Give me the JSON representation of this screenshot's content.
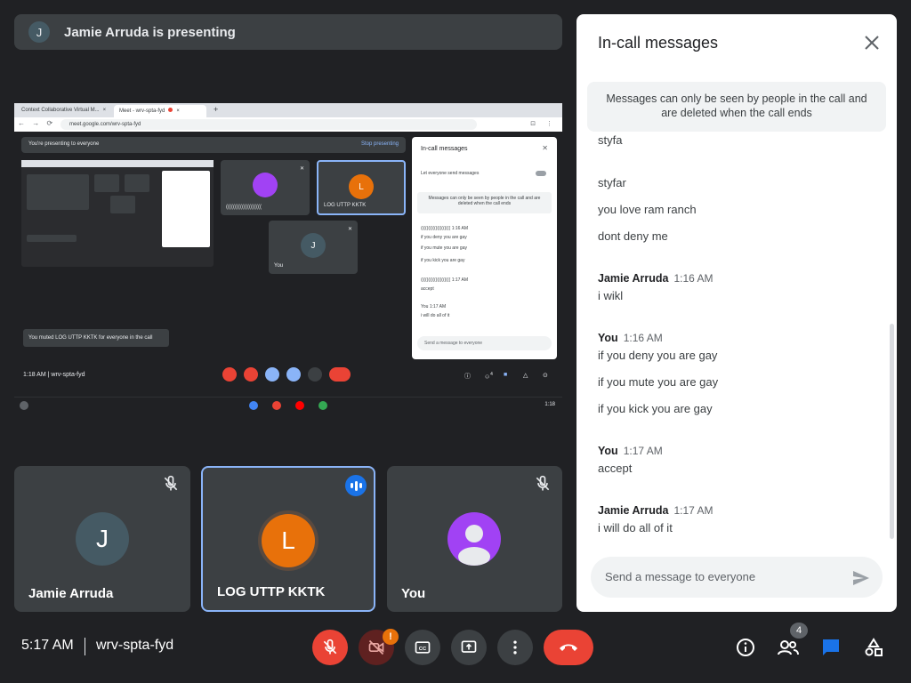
{
  "presenter_banner": {
    "initial": "J",
    "text": "Jamie Arruda is presenting"
  },
  "shared_screen": {
    "tabs": [
      "Context Collaborative Virtual M...",
      "Meet - wrv-spta-fyd"
    ],
    "url": "meet.google.com/wrv-spta-fyd",
    "banner_text": "You're presenting to everyone",
    "stop_label": "Stop presenting",
    "tile_labels": [
      "((((((((((((((((((((",
      "LOG UTTP KKTK",
      "You"
    ],
    "tile_initials": [
      "L",
      "J"
    ],
    "chat": {
      "title": "In-call messages",
      "toggle_label": "Let everyone send messages",
      "notice": "Messages can only be seen by people in the call and are deleted when the call ends",
      "lines": [
        "((((((((((((((((((((   1:16 AM",
        "if you deny you are gay",
        "if you mute you are gay",
        "if you kick you are gay",
        "((((((((((((((((((((   1:17 AM",
        "accept",
        "You   1:17 AM",
        "i will do all of it"
      ],
      "input_placeholder": "Send a message to everyone"
    },
    "toast": "You muted LOG UTTP KKTK for everyone in the call",
    "meeting_info": "1:18 AM  |  wrv-spta-fyd",
    "people_count": "4",
    "shelf_time": "1:18"
  },
  "tiles": [
    {
      "initial": "J",
      "name": "Jamie Arruda",
      "muted": true
    },
    {
      "initial": "L",
      "name": "LOG UTTP KKTK",
      "speaking": true
    },
    {
      "initial": "",
      "name": "You",
      "muted": true
    }
  ],
  "chat_panel": {
    "title": "In-call messages",
    "notice": "Messages can only be seen by people in the call and are deleted when the call ends",
    "messages": [
      {
        "text": "styfa"
      },
      {
        "text": "styfar"
      },
      {
        "text": "you love ram ranch"
      },
      {
        "text": "dont deny me"
      },
      {
        "sender": "Jamie Arruda",
        "time": "1:16 AM"
      },
      {
        "text": "i wikl"
      },
      {
        "sender": "You",
        "time": "1:16 AM"
      },
      {
        "text": "if you deny you are gay"
      },
      {
        "text": "if you mute you are gay"
      },
      {
        "text": "if you kick you are gay"
      },
      {
        "sender": "You",
        "time": "1:17 AM"
      },
      {
        "text": "accept"
      },
      {
        "sender": "Jamie Arruda",
        "time": "1:17 AM"
      },
      {
        "text": "i will do all of it"
      }
    ],
    "input_placeholder": "Send a message to everyone"
  },
  "bottom_bar": {
    "time": "5:17 AM",
    "meeting_code": "wrv-spta-fyd",
    "camera_warning": "!",
    "people_count": "4",
    "controls": [
      "mic-off-icon",
      "camera-off-icon",
      "captions-icon",
      "present-screen-icon",
      "more-options-icon",
      "end-call-icon"
    ],
    "right_icons": [
      "info-icon",
      "people-icon",
      "chat-icon",
      "activities-icon"
    ]
  },
  "colors": {
    "background": "#202124",
    "tile": "#3c4043",
    "red": "#ea4335",
    "blue": "#1a73e8",
    "chat_blue": "#1a73e8",
    "orange": "#e8710a",
    "purple": "#a142f4",
    "accent_outline": "#8ab4f8"
  }
}
